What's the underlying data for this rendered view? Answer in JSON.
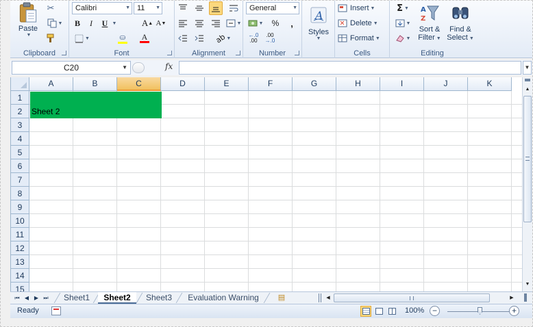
{
  "ribbon": {
    "clipboard": {
      "label": "Clipboard",
      "paste": "Paste",
      "cut_icon": "scissors-icon",
      "copy_icon": "copy-icon",
      "format_painter_icon": "paintbrush-icon"
    },
    "font": {
      "label": "Font",
      "font_name": "Calibri",
      "font_size": "11",
      "bold": "B",
      "italic": "I",
      "underline": "U",
      "grow": "A",
      "shrink": "A",
      "font_color": "A",
      "font_color_swatch": "#ff0000",
      "fill_color_swatch": "#ffff00"
    },
    "alignment": {
      "label": "Alignment"
    },
    "number": {
      "label": "Number",
      "format": "General",
      "percent": "%",
      "comma": ",",
      "inc_decimal": ".00",
      "dec_decimal": ".00"
    },
    "styles": {
      "label": "Styles"
    },
    "cells": {
      "label": "Cells",
      "insert": "Insert",
      "delete": "Delete",
      "format": "Format"
    },
    "editing": {
      "label": "Editing",
      "sum": "Σ",
      "sort_filter_line1": "Sort &",
      "sort_filter_line2": "Filter",
      "find_select_line1": "Find &",
      "find_select_line2": "Select"
    }
  },
  "formula_bar": {
    "name_box": "C20",
    "fx": "fx",
    "formula": ""
  },
  "grid": {
    "columns": [
      "A",
      "B",
      "C",
      "D",
      "E",
      "F",
      "G",
      "H",
      "I",
      "J",
      "K"
    ],
    "active_column": "C",
    "rows": [
      "1",
      "2",
      "3",
      "4",
      "5",
      "6",
      "7",
      "8",
      "9",
      "10",
      "11",
      "12",
      "13",
      "14",
      "15"
    ],
    "fill_color": "#00b050",
    "cells": {
      "A2": "Sheet 2"
    }
  },
  "tabs": {
    "sheets": [
      "Sheet1",
      "Sheet2",
      "Sheet3",
      "Evaluation Warning"
    ],
    "active": "Sheet2"
  },
  "status": {
    "mode": "Ready",
    "zoom": "100%",
    "zoom_fraction": 0.5
  }
}
